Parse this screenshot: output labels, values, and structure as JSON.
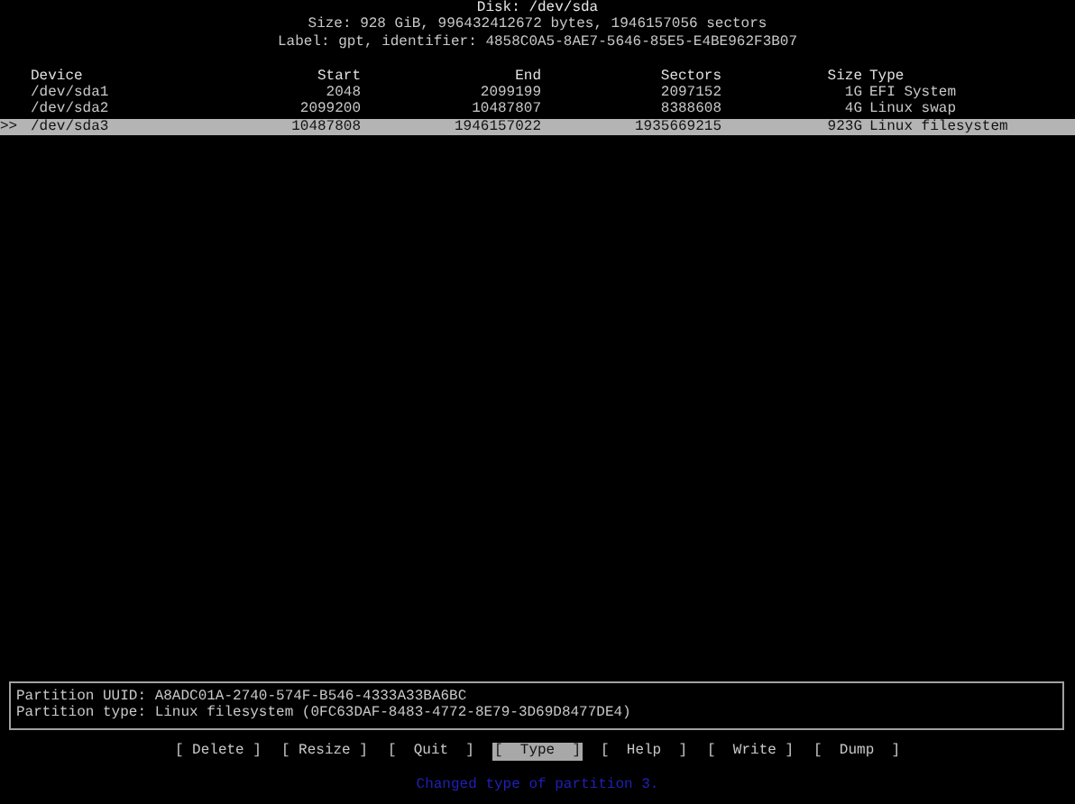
{
  "disk": {
    "title": "Disk: /dev/sda",
    "size": "Size: 928 GiB, 996432412672 bytes, 1946157056 sectors",
    "label": "Label: gpt, identifier: 4858C0A5-8AE7-5646-85E5-E4BE962F3B07"
  },
  "table": {
    "columns": [
      "Device",
      "Start",
      "End",
      "Sectors",
      "Size",
      "Type"
    ],
    "cursor": ">>",
    "rows": [
      {
        "cells": [
          "/dev/sda1",
          "2048",
          "2099199",
          "2097152",
          "1G",
          "EFI System"
        ],
        "selected": false
      },
      {
        "cells": [
          "/dev/sda2",
          "2099200",
          "10487807",
          "8388608",
          "4G",
          "Linux swap"
        ],
        "selected": false
      },
      {
        "cells": [
          "/dev/sda3",
          "10487808",
          "1946157022",
          "1935669215",
          "923G",
          "Linux filesystem"
        ],
        "selected": true
      }
    ]
  },
  "info": {
    "lines": [
      "Partition UUID: A8ADC01A-2740-574F-B546-4333A33BA6BC",
      "Partition type: Linux filesystem (0FC63DAF-8483-4772-8E79-3D69D8477DE4)"
    ]
  },
  "menu": [
    {
      "label": "[ Delete ]",
      "selected": false
    },
    {
      "label": "[ Resize ]",
      "selected": false
    },
    {
      "label": "[  Quit  ]",
      "selected": false
    },
    {
      "label": "[  Type  ]",
      "selected": true
    },
    {
      "label": "[  Help  ]",
      "selected": false
    },
    {
      "label": "[  Write ]",
      "selected": false
    },
    {
      "label": "[  Dump  ]",
      "selected": false
    }
  ],
  "status": "Changed type of partition 3."
}
